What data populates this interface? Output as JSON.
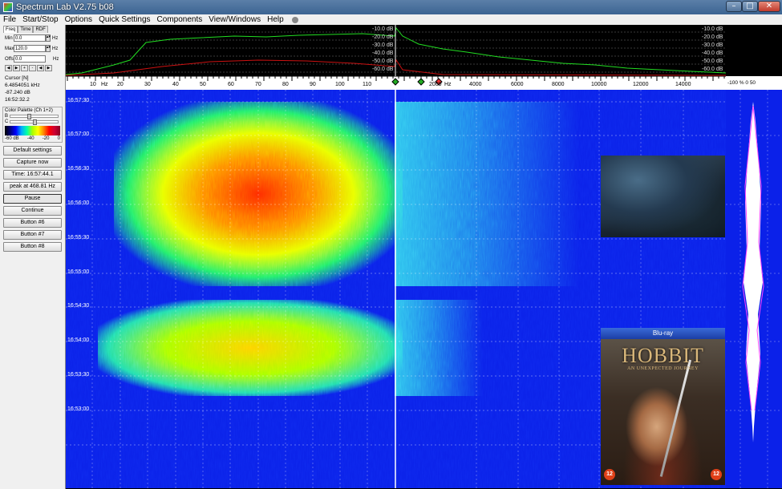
{
  "window": {
    "title": "Spectrum Lab V2.75 b08",
    "buttons": {
      "minimize": "–",
      "maximize": "□",
      "close": "✕"
    }
  },
  "menu": [
    "File",
    "Start/Stop",
    "Options",
    "Quick Settings",
    "Components",
    "View/Windows",
    "Help"
  ],
  "left_panel": {
    "tabs": [
      "Freq",
      "Time",
      "RDF"
    ],
    "freq": {
      "min_label": "Min",
      "min_value": "0.0",
      "min_unit": "Hz",
      "max_label": "Max",
      "max_value": "120.0",
      "max_unit": "Hz",
      "offs_label": "Offs",
      "offs_value": "0.0",
      "offs_unit": "Hz"
    },
    "arrows": [
      "◀",
      "▶",
      "+",
      "-",
      "◀",
      "▶"
    ],
    "cursor": {
      "title": "Cursor [N]",
      "freq": "6.4854051 kHz",
      "level": "-87.240 dB",
      "time": "16:52:32.2"
    },
    "palette": {
      "title": "Color Palette (Ch 1+2)",
      "b_label": "B",
      "c_label": "C",
      "ticks": [
        "-60 dB",
        "-40",
        "-20",
        "0"
      ]
    },
    "buttons": [
      "Default settings",
      "Capture now",
      "Time:  16:57:44.1",
      "peak at 468.81 Hz",
      "Pause",
      "Continue",
      "Button #6",
      "Button #7",
      "Button #8"
    ]
  },
  "spectrum": {
    "db_labels": [
      "-10.0 dB",
      "-20.0 dB",
      "-30.0 dB",
      "-40.0 dB",
      "-50.0 dB",
      "-60.0 dB"
    ],
    "right_db_labels": [
      "-10 dB",
      "-20 dB",
      "-30 dB",
      "-40 dB",
      "-50 dB",
      "-60 dB"
    ]
  },
  "freq_scale": {
    "left_ticks": [
      "10",
      "Hz",
      "20",
      "30",
      "40",
      "50",
      "60",
      "70",
      "80",
      "90",
      "100",
      "110"
    ],
    "right_ticks": [
      "2000",
      "Hz",
      "4000",
      "6000",
      "8000",
      "10000",
      "12000",
      "14000"
    ],
    "right_panel_scale": "-100  %  0   50"
  },
  "waterfall": {
    "time_labels": [
      "16:57:30",
      "16:57:00",
      "16:56:30",
      "16:56:00",
      "16:55:30",
      "16:55:00",
      "16:54:30",
      "16:54:00",
      "16:53:30",
      "16:53:00"
    ]
  },
  "poster": {
    "bluray": "Blu-ray",
    "title": "HOBBIT",
    "subtitle": "AN UNEXPECTED JOURNEY",
    "rating": "12"
  },
  "colors": {
    "waterfall_bg": "#0b21e9",
    "spectrum_trace": "#22dd22",
    "spectrum_ref": "#cc1111"
  }
}
